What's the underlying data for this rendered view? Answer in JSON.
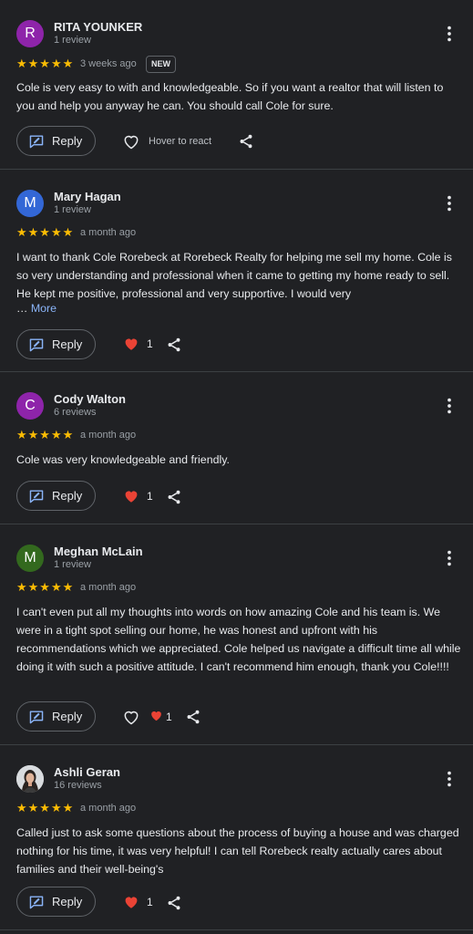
{
  "reviews": [
    {
      "initial": "R",
      "avatar_color": "#8e24aa",
      "name": "RITA YOUNKER",
      "count": "1 review",
      "stars": "★★★★★",
      "time": "3 weeks ago",
      "badge": "NEW",
      "text": "Cole is very easy to with and knowledgeable. So if you want a realtor that will listen to you and help you anyway he can. You should call Cole for sure.",
      "reply_label": "Reply",
      "hover_label": "Hover to react"
    },
    {
      "initial": "M",
      "avatar_color": "#3367d6",
      "name": "Mary Hagan",
      "count": "1 review",
      "stars": "★★★★★",
      "time": "a month ago",
      "text": "I want to thank Cole Rorebeck at Rorebeck Realty for helping me sell my home. Cole is so very understanding and professional when it came to getting my home ready to sell. He kept me positive, professional and very supportive. I would very",
      "ellipsis": "…",
      "more_label": "More",
      "reply_label": "Reply",
      "reaction_count": "1"
    },
    {
      "initial": "C",
      "avatar_color": "#8e24aa",
      "name": "Cody Walton",
      "count": "6 reviews",
      "stars": "★★★★★",
      "time": "a month ago",
      "text": "Cole was very knowledgeable and friendly.",
      "reply_label": "Reply",
      "reaction_count": "1"
    },
    {
      "initial": "M",
      "avatar_color": "#33691e",
      "name": "Meghan McLain",
      "count": "1 review",
      "stars": "★★★★★",
      "time": "a month ago",
      "text": "I can't even put all my thoughts into words on how amazing Cole and his team is. We were in a tight spot selling our home, he was honest and upfront with his recommendations which we appreciated. Cole helped us navigate a difficult time all while doing it with such a positive attitude. I can't recommend him enough, thank you Cole!!!!",
      "reply_label": "Reply",
      "reaction_count": "1"
    },
    {
      "name": "Ashli Geran",
      "count": "16 reviews",
      "stars": "★★★★★",
      "time": "a month ago",
      "text": "Called just to ask some questions about the process of buying a house and was charged nothing for his time, it was very helpful! I can tell Rorebeck realty actually cares about families and their well-being's",
      "reply_label": "Reply",
      "reaction_count": "1"
    }
  ],
  "colors": {
    "background": "#202124",
    "star": "#fbbc04",
    "link": "#8ab4f8",
    "reply_icon": "#8ab4f8",
    "heart": "#ea4335"
  }
}
